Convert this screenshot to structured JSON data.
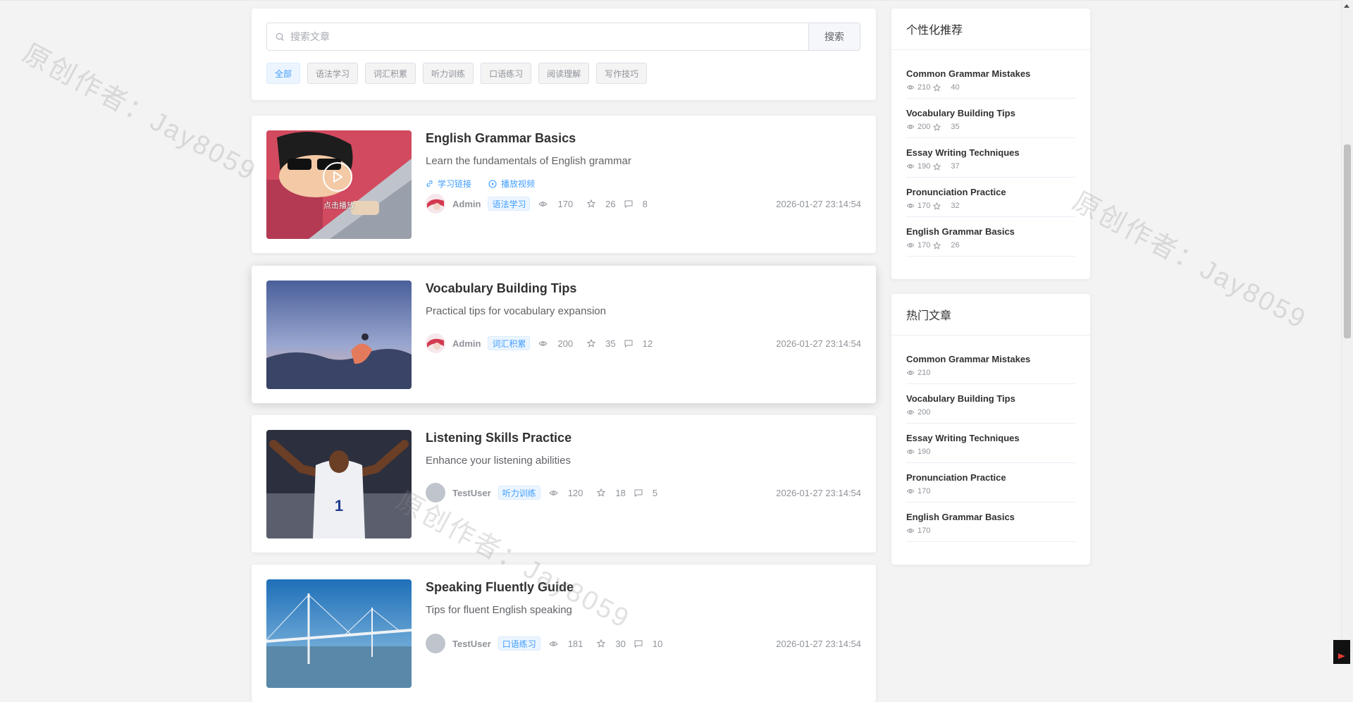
{
  "search": {
    "placeholder": "搜索文章",
    "button": "搜索"
  },
  "tags": [
    "全部",
    "语法学习",
    "词汇积累",
    "听力训练",
    "口语练习",
    "阅读理解",
    "写作技巧"
  ],
  "articles": [
    {
      "title": "English Grammar Basics",
      "desc": "Learn the fundamentals of English grammar",
      "author": "Admin",
      "category": "语法学习",
      "views": "170",
      "stars": "26",
      "comments": "8",
      "date": "2026-01-27 23:14:54",
      "link_label": "学习链接",
      "video_label": "播放视频",
      "play_label": "点击播放"
    },
    {
      "title": "Vocabulary Building Tips",
      "desc": "Practical tips for vocabulary expansion",
      "author": "Admin",
      "category": "词汇积累",
      "views": "200",
      "stars": "35",
      "comments": "12",
      "date": "2026-01-27 23:14:54"
    },
    {
      "title": "Listening Skills Practice",
      "desc": "Enhance your listening abilities",
      "author": "TestUser",
      "category": "听力训练",
      "views": "120",
      "stars": "18",
      "comments": "5",
      "date": "2026-01-27 23:14:54"
    },
    {
      "title": "Speaking Fluently Guide",
      "desc": "Tips for fluent English speaking",
      "author": "TestUser",
      "category": "口语练习",
      "views": "181",
      "stars": "30",
      "comments": "10",
      "date": "2026-01-27 23:14:54"
    }
  ],
  "recommend": {
    "title": "个性化推荐",
    "items": [
      {
        "title": "Common Grammar Mistakes",
        "views": "210",
        "stars": "40"
      },
      {
        "title": "Vocabulary Building Tips",
        "views": "200",
        "stars": "35"
      },
      {
        "title": "Essay Writing Techniques",
        "views": "190",
        "stars": "37"
      },
      {
        "title": "Pronunciation Practice",
        "views": "170",
        "stars": "32"
      },
      {
        "title": "English Grammar Basics",
        "views": "170",
        "stars": "26"
      }
    ]
  },
  "hot": {
    "title": "热门文章",
    "items": [
      {
        "title": "Common Grammar Mistakes",
        "views": "210"
      },
      {
        "title": "Vocabulary Building Tips",
        "views": "200"
      },
      {
        "title": "Essay Writing Techniques",
        "views": "190"
      },
      {
        "title": "Pronunciation Practice",
        "views": "170"
      },
      {
        "title": "English Grammar Basics",
        "views": "170"
      }
    ]
  },
  "watermark": "原创作者：Jay8059",
  "colors": {
    "accent": "#409eff",
    "tag_bg": "#ecf5ff",
    "text_muted": "#909399"
  }
}
